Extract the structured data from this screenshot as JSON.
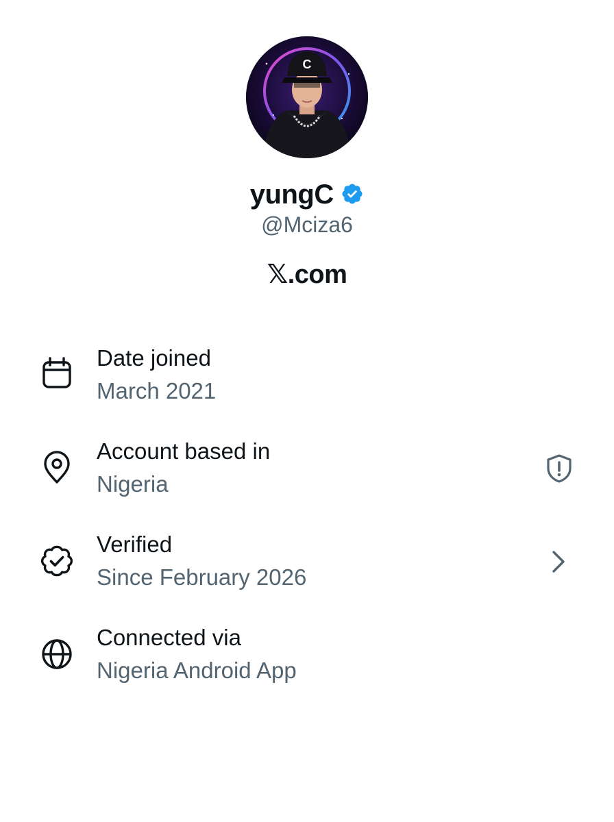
{
  "profile": {
    "display_name": "yungC",
    "handle": "@Mciza6",
    "site": "𝕏.com",
    "avatar_letter": "C",
    "verified_color": "#1d9bf0"
  },
  "about": {
    "items": [
      {
        "title": "Date joined",
        "value": "March 2021",
        "icon": "calendar-icon"
      },
      {
        "title": "Account based in",
        "value": "Nigeria",
        "icon": "location-pin-icon",
        "trailing_icon": "shield-alert-icon"
      },
      {
        "title": "Verified",
        "value": "Since February 2026",
        "icon": "verified-badge-icon",
        "trailing_icon": "chevron-right-icon"
      },
      {
        "title": "Connected via",
        "value": "Nigeria Android App",
        "icon": "globe-icon"
      }
    ]
  },
  "colors": {
    "primary_text": "#0f1419",
    "secondary_text": "#536471",
    "background": "#ffffff"
  }
}
